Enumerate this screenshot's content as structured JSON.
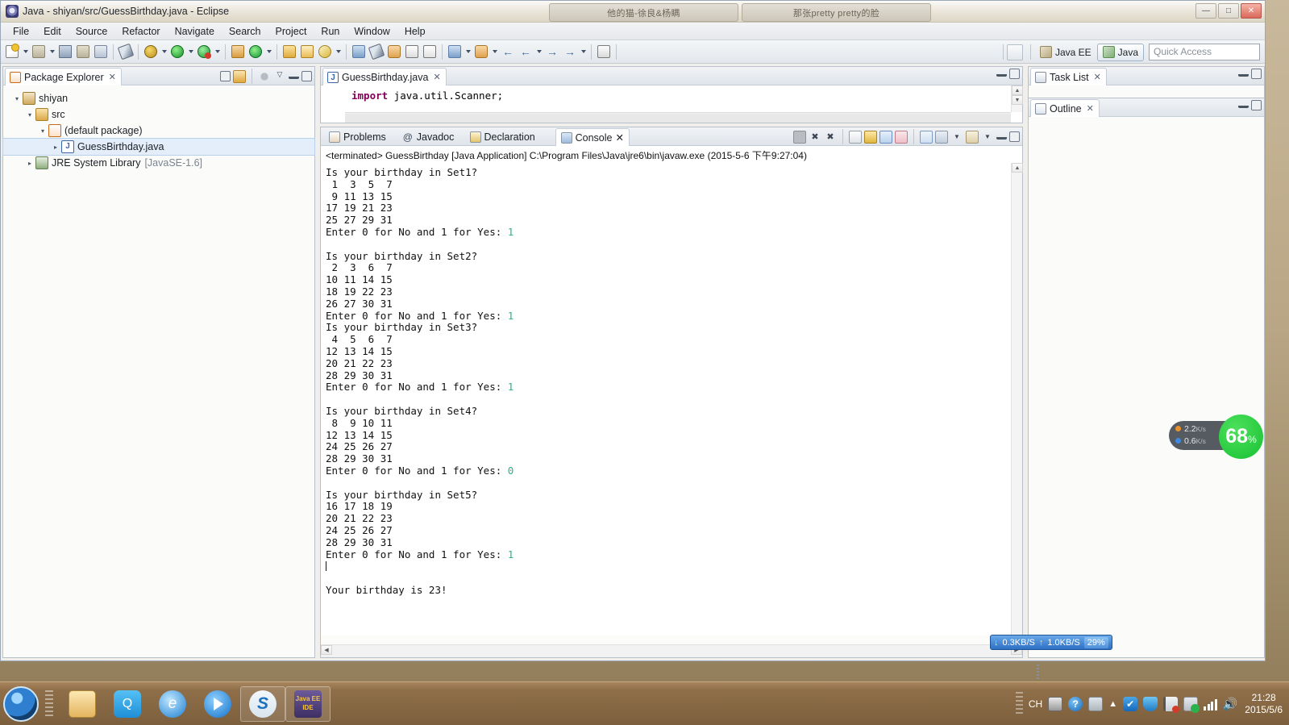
{
  "window": {
    "title": "Java - shiyan/src/GuessBirthday.java - Eclipse",
    "title_icon": "eclipse-icon",
    "buttons": {
      "minimize": "—",
      "maximize": "□",
      "close": "✕"
    }
  },
  "media_tabs": [
    {
      "label": "他的猫-徐良&杨瞒"
    },
    {
      "label": "那张pretty pretty的脸"
    }
  ],
  "menu": [
    "File",
    "Edit",
    "Source",
    "Refactor",
    "Navigate",
    "Search",
    "Project",
    "Run",
    "Window",
    "Help"
  ],
  "toolbar": {
    "groups": [
      {
        "items": [
          {
            "name": "new-wizard-icon",
            "glyph": "doc",
            "dropdown": true
          },
          {
            "name": "new-java-class-icon",
            "glyph": "save2",
            "dropdown": true
          },
          {
            "name": "save-icon",
            "glyph": "save",
            "dropdown": false
          },
          {
            "name": "save-all-icon",
            "glyph": "save2",
            "dropdown": false
          },
          {
            "name": "print-icon",
            "glyph": "print",
            "dropdown": false
          }
        ]
      },
      {
        "items": [
          {
            "name": "toggle-mark-occurrences-icon",
            "glyph": "pen",
            "dropdown": false
          }
        ]
      },
      {
        "items": [
          {
            "name": "external-tools-icon",
            "glyph": "bug",
            "dropdown": true
          },
          {
            "name": "run-icon",
            "glyph": "run",
            "dropdown": true
          },
          {
            "name": "debug-icon",
            "glyph": "runerr",
            "dropdown": true
          }
        ]
      },
      {
        "items": [
          {
            "name": "new-java-package-icon",
            "glyph": "newpkg",
            "dropdown": false
          },
          {
            "name": "refresh-icon",
            "glyph": "refresh",
            "dropdown": true
          }
        ]
      },
      {
        "items": [
          {
            "name": "open-type-icon",
            "glyph": "folder",
            "dropdown": false
          },
          {
            "name": "open-task-icon",
            "glyph": "folder2",
            "dropdown": false
          },
          {
            "name": "search-icon",
            "glyph": "search",
            "dropdown": true
          }
        ]
      },
      {
        "items": [
          {
            "name": "last-edit-location-icon",
            "glyph": "undo",
            "dropdown": false
          },
          {
            "name": "next-annotation-icon",
            "glyph": "pen",
            "dropdown": false
          },
          {
            "name": "previous-annotation-icon",
            "glyph": "cloud",
            "dropdown": false
          },
          {
            "name": "toggle-block-selection-icon",
            "glyph": "table",
            "dropdown": false
          },
          {
            "name": "toggle-word-wrap-icon",
            "glyph": "tablev",
            "dropdown": false
          }
        ]
      },
      {
        "items": [
          {
            "name": "next-edit-icon",
            "glyph": "undo",
            "dropdown": true
          },
          {
            "name": "prev-edit-icon",
            "glyph": "cloud",
            "dropdown": true
          },
          {
            "name": "back-icon",
            "glyph": "back",
            "dropdown": false
          },
          {
            "name": "back-history-icon",
            "glyph": "back",
            "dropdown": true
          },
          {
            "name": "forward-icon",
            "glyph": "fwd",
            "dropdown": false
          },
          {
            "name": "forward-history-icon",
            "glyph": "fwd",
            "dropdown": true
          }
        ]
      },
      {
        "items": [
          {
            "name": "pin-editor-icon",
            "glyph": "sq",
            "dropdown": false
          }
        ]
      }
    ],
    "open_perspective_label": "",
    "perspectives": [
      {
        "label": "Java EE",
        "active": false,
        "icon": "java-ee-perspective-icon"
      },
      {
        "label": "Java",
        "active": true,
        "icon": "java-perspective-icon"
      }
    ],
    "quick_access_placeholder": "Quick Access"
  },
  "package_explorer": {
    "tab_label": "Package Explorer",
    "tab_icon": "package-explorer-icon",
    "tools": [
      "collapse-all-icon",
      "link-with-editor-icon",
      "view-menu-icon",
      "minimize-icon",
      "maximize-icon"
    ],
    "tree": [
      {
        "indent": 0,
        "twist": "▾",
        "icon": "project-icon",
        "label": "shiyan",
        "suffix": "",
        "selected": false
      },
      {
        "indent": 1,
        "twist": "▾",
        "icon": "source-folder-icon",
        "label": "src",
        "suffix": "",
        "selected": false
      },
      {
        "indent": 2,
        "twist": "▾",
        "icon": "package-icon",
        "label": "(default package)",
        "suffix": "",
        "selected": false
      },
      {
        "indent": 3,
        "twist": "▸",
        "icon": "java-file-icon",
        "label": "GuessBirthday.java",
        "suffix": "",
        "selected": true
      },
      {
        "indent": 1,
        "twist": "▸",
        "icon": "jre-library-icon",
        "label": "JRE System Library",
        "suffix": "[JavaSE-1.6]",
        "selected": false
      }
    ]
  },
  "editor": {
    "tab_label": "GuessBirthday.java",
    "tab_icon": "java-file-icon",
    "code_keyword": "import",
    "code_rest": " java.util.Scanner;"
  },
  "console_view": {
    "tabs": [
      {
        "label": "Problems",
        "icon": "problems-icon",
        "active": false
      },
      {
        "label": "Javadoc",
        "icon": "javadoc-icon",
        "active": false
      },
      {
        "label": "Declaration",
        "icon": "declaration-icon",
        "active": false
      },
      {
        "label": "Console",
        "icon": "console-icon",
        "active": true
      }
    ],
    "header": "<terminated> GuessBirthday [Java Application] C:\\Program Files\\Java\\jre6\\bin\\javaw.exe (2015-5-6 下午9:27:04)",
    "tools": [
      "terminate-icon",
      "remove-launch-icon",
      "remove-all-terminated-icon",
      "clear-console-icon",
      "scroll-lock-icon",
      "show-console-on-output-icon",
      "show-console-on-error-icon",
      "pin-console-icon",
      "display-selected-console-icon",
      "display-console-dropdown-icon",
      "open-console-icon",
      "open-console-dropdown-icon",
      "minimize-icon",
      "maximize-icon"
    ],
    "output": [
      {
        "text": "Is your birthday in Set1?",
        "input": ""
      },
      {
        "text": " 1  3  5  7",
        "input": ""
      },
      {
        "text": " 9 11 13 15",
        "input": ""
      },
      {
        "text": "17 19 21 23",
        "input": ""
      },
      {
        "text": "25 27 29 31",
        "input": ""
      },
      {
        "text": "Enter 0 for No and 1 for Yes: ",
        "input": "1"
      },
      {
        "text": "",
        "input": ""
      },
      {
        "text": "Is your birthday in Set2?",
        "input": ""
      },
      {
        "text": " 2  3  6  7",
        "input": ""
      },
      {
        "text": "10 11 14 15",
        "input": ""
      },
      {
        "text": "18 19 22 23",
        "input": ""
      },
      {
        "text": "26 27 30 31",
        "input": ""
      },
      {
        "text": "Enter 0 for No and 1 for Yes: ",
        "input": "1"
      },
      {
        "text": "Is your birthday in Set3?",
        "input": ""
      },
      {
        "text": " 4  5  6  7",
        "input": ""
      },
      {
        "text": "12 13 14 15",
        "input": ""
      },
      {
        "text": "20 21 22 23",
        "input": ""
      },
      {
        "text": "28 29 30 31",
        "input": ""
      },
      {
        "text": "Enter 0 for No and 1 for Yes: ",
        "input": "1"
      },
      {
        "text": "",
        "input": ""
      },
      {
        "text": "Is your birthday in Set4?",
        "input": ""
      },
      {
        "text": " 8  9 10 11",
        "input": ""
      },
      {
        "text": "12 13 14 15",
        "input": ""
      },
      {
        "text": "24 25 26 27",
        "input": ""
      },
      {
        "text": "28 29 30 31",
        "input": ""
      },
      {
        "text": "Enter 0 for No and 1 for Yes: ",
        "input": "0"
      },
      {
        "text": "",
        "input": ""
      },
      {
        "text": "Is your birthday in Set5?",
        "input": ""
      },
      {
        "text": "16 17 18 19",
        "input": ""
      },
      {
        "text": "20 21 22 23",
        "input": ""
      },
      {
        "text": "24 25 26 27",
        "input": ""
      },
      {
        "text": "28 29 30 31",
        "input": ""
      },
      {
        "text": "Enter 0 for No and 1 for Yes: ",
        "input": "1"
      },
      {
        "text": "CARET",
        "input": ""
      },
      {
        "text": "",
        "input": ""
      },
      {
        "text": "Your birthday is 23!",
        "input": ""
      }
    ]
  },
  "task_list": {
    "tab_label": "Task List",
    "tab_icon": "task-list-icon"
  },
  "outline": {
    "tab_label": "Outline",
    "tab_icon": "outline-icon"
  },
  "net_widget": {
    "upload": "2.2",
    "upload_unit": "K/s",
    "download": "0.6",
    "download_unit": "K/s",
    "percent": "68",
    "percent_unit": "%"
  },
  "speed_bar": {
    "down_label": "0.3KB/S",
    "up_label": "1.0KB/S",
    "percent": "29%"
  },
  "taskbar": {
    "start": "start-orb-icon",
    "apps": [
      {
        "name": "file-explorer-icon",
        "cls": "a-explorer",
        "label": "",
        "pinned": false
      },
      {
        "name": "qq-icon",
        "cls": "a-qq",
        "label": "Q",
        "pinned": false
      },
      {
        "name": "internet-explorer-icon",
        "cls": "a-ie",
        "label": "e",
        "pinned": false
      },
      {
        "name": "media-player-icon",
        "cls": "a-play",
        "label": "",
        "pinned": false
      },
      {
        "name": "sogou-icon",
        "cls": "a-s",
        "label": "S",
        "pinned": true
      },
      {
        "name": "eclipse-java-ee-ide-icon",
        "cls": "a-java",
        "label": "Java EE IDE",
        "pinned": true
      }
    ],
    "tray": {
      "ime": "CH",
      "time": "21:28",
      "date": "2015/5/6"
    }
  }
}
